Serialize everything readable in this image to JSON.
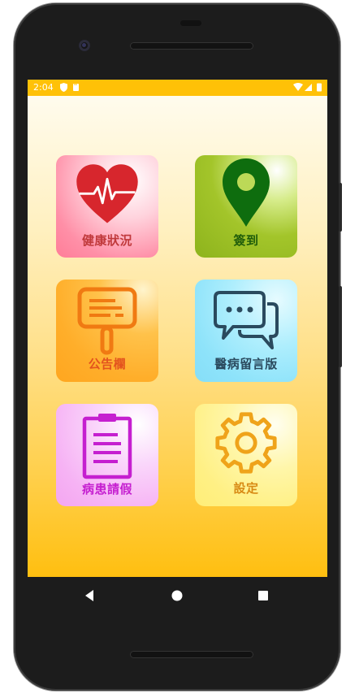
{
  "status_bar": {
    "time": "2:04"
  },
  "tiles": [
    {
      "id": "health",
      "label": "健康狀況",
      "icon": "heart-pulse-icon",
      "color": "#c0393b"
    },
    {
      "id": "checkin",
      "label": "簽到",
      "icon": "location-pin-icon",
      "color": "#1f5c0a"
    },
    {
      "id": "bulletin",
      "label": "公告欄",
      "icon": "signboard-icon",
      "color": "#e3541e"
    },
    {
      "id": "messages",
      "label": "醫病留言版",
      "icon": "chat-bubbles-icon",
      "color": "#2a4a5e"
    },
    {
      "id": "leave",
      "label": "病患請假",
      "icon": "clipboard-icon",
      "color": "#c51fd0"
    },
    {
      "id": "settings",
      "label": "設定",
      "icon": "gear-icon",
      "color": "#d88a14"
    }
  ],
  "nav": {
    "back": "back-icon",
    "home": "home-icon",
    "recents": "recents-icon"
  }
}
